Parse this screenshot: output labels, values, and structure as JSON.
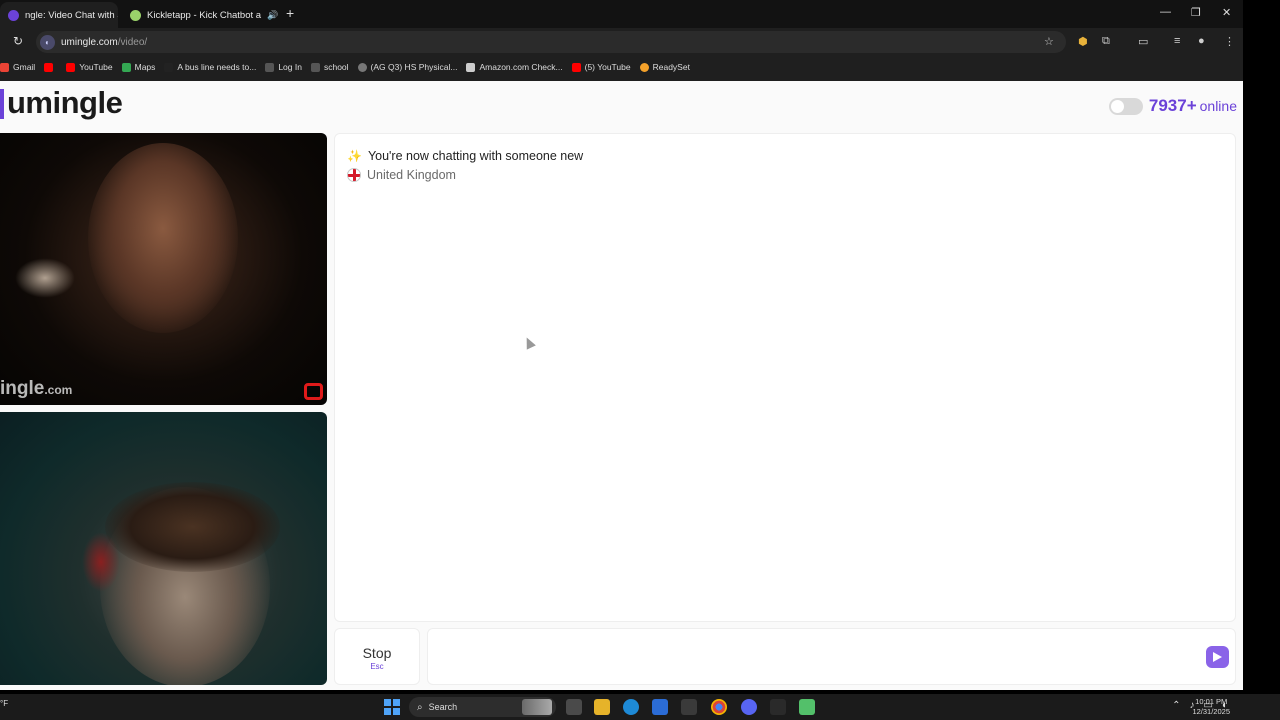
{
  "browser": {
    "tabs": [
      {
        "title": "ngle: Video Chat with S",
        "active": true
      },
      {
        "title": "Kickletapp - Kick Chatbot a",
        "active": false
      }
    ],
    "url_host": "umingle.com",
    "url_path": "/video/",
    "bookmarks": [
      {
        "label": "Gmail",
        "color": "#ea4335"
      },
      {
        "label": "",
        "color": "#ff0000"
      },
      {
        "label": "YouTube",
        "color": "#ff0000"
      },
      {
        "label": "Maps",
        "color": "#34a853"
      },
      {
        "label": "A bus line needs to...",
        "color": "#222222"
      },
      {
        "label": "Log In",
        "color": "#555555"
      },
      {
        "label": "school",
        "color": "#555555"
      },
      {
        "label": "(AG Q3) HS Physical...",
        "color": "#777777"
      },
      {
        "label": "Amazon.com Check...",
        "color": "#cccccc"
      },
      {
        "label": "(5) YouTube",
        "color": "#ff0000"
      },
      {
        "label": "ReadySet",
        "color": "#f4a12a"
      }
    ]
  },
  "site": {
    "logo": "umingle",
    "online_count": "7937+",
    "online_label": "online",
    "accent": "#6b42d8"
  },
  "video": {
    "watermark": "ingle",
    "watermark_domain": ".com"
  },
  "chat": {
    "status": "You're now chatting with someone new",
    "country": "United Kingdom"
  },
  "controls": {
    "stop_label": "Stop",
    "stop_key": "Esc",
    "message_placeholder": ""
  },
  "taskbar": {
    "weather": "°F",
    "search_label": "Search",
    "time": "10:01 PM",
    "date": "12/31/2025"
  }
}
